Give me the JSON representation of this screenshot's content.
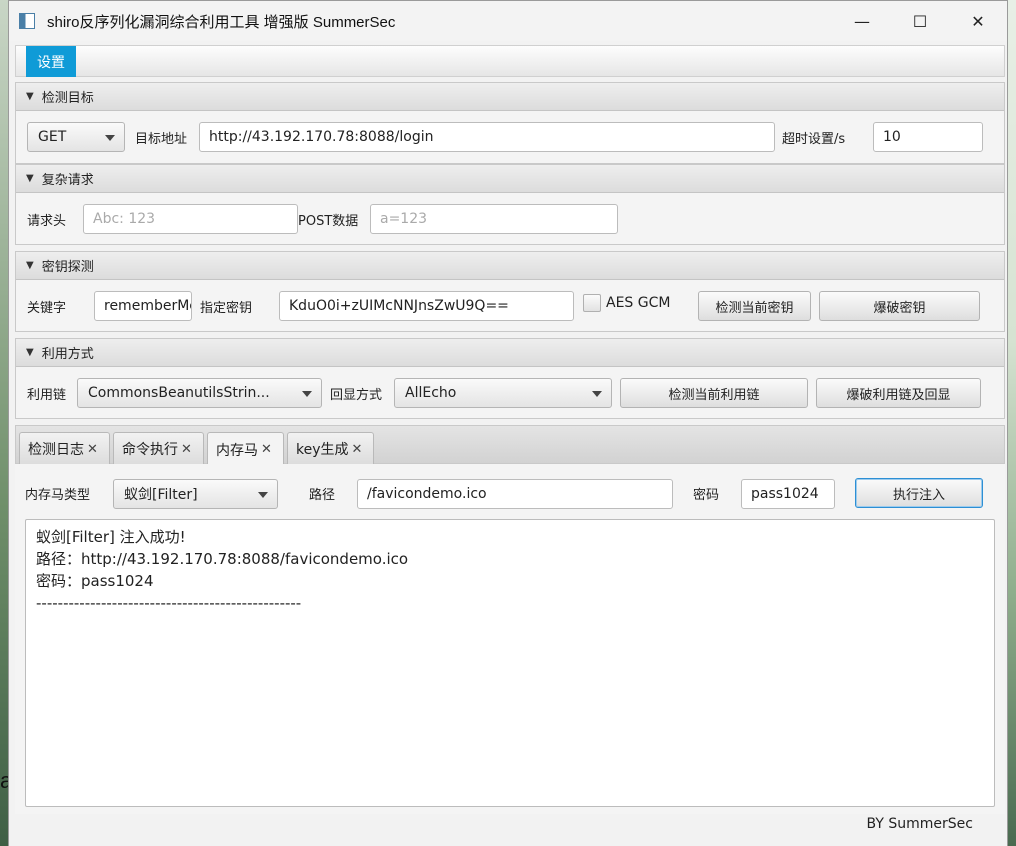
{
  "window": {
    "title": "shiro反序列化漏洞综合利用工具 增强版 SummerSec",
    "minimize": "—",
    "maximize": "☐",
    "close": "✕"
  },
  "menu": {
    "settings": "设置"
  },
  "target": {
    "header": "检测目标",
    "method": "GET",
    "url_label": "目标地址",
    "url": "http://43.192.170.78:8088/login",
    "timeout_label": "超时设置/s",
    "timeout": "10"
  },
  "complex": {
    "header": "复杂请求",
    "headers_label": "请求头",
    "headers_placeholder": "Abc: 123",
    "post_label": "POST数据",
    "post_placeholder": "a=123"
  },
  "key": {
    "header": "密钥探测",
    "keyword_label": "关键字",
    "keyword": "rememberMe",
    "key_label": "指定密钥",
    "key_value": "KduO0i+zUIMcNNJnsZwU9Q==",
    "aes_gcm": "AES GCM",
    "check_btn": "检测当前密钥",
    "brute_btn": "爆破密钥"
  },
  "exploit": {
    "header": "利用方式",
    "chain_label": "利用链",
    "chain": "CommonsBeanutilsStrin...",
    "echo_label": "回显方式",
    "echo": "AllEcho",
    "check_btn": "检测当前利用链",
    "brute_btn": "爆破利用链及回显"
  },
  "tabs": [
    {
      "label": "检测日志"
    },
    {
      "label": "命令执行"
    },
    {
      "label": "内存马"
    },
    {
      "label": "key生成"
    }
  ],
  "memshell": {
    "type_label": "内存马类型",
    "type": "蚁剑[Filter]",
    "path_label": "路径",
    "path": "/favicondemo.ico",
    "pwd_label": "密码",
    "pwd": "pass1024",
    "inject_btn": "执行注入",
    "log_lines": [
      "蚁剑[Filter]  注入成功!",
      "路径：http://43.192.170.78:8088/favicondemo.ico",
      "密码：pass1024",
      "-------------------------------------------------"
    ]
  },
  "footer": "BY   SummerSec",
  "background": {
    "partial_letter": "a"
  }
}
